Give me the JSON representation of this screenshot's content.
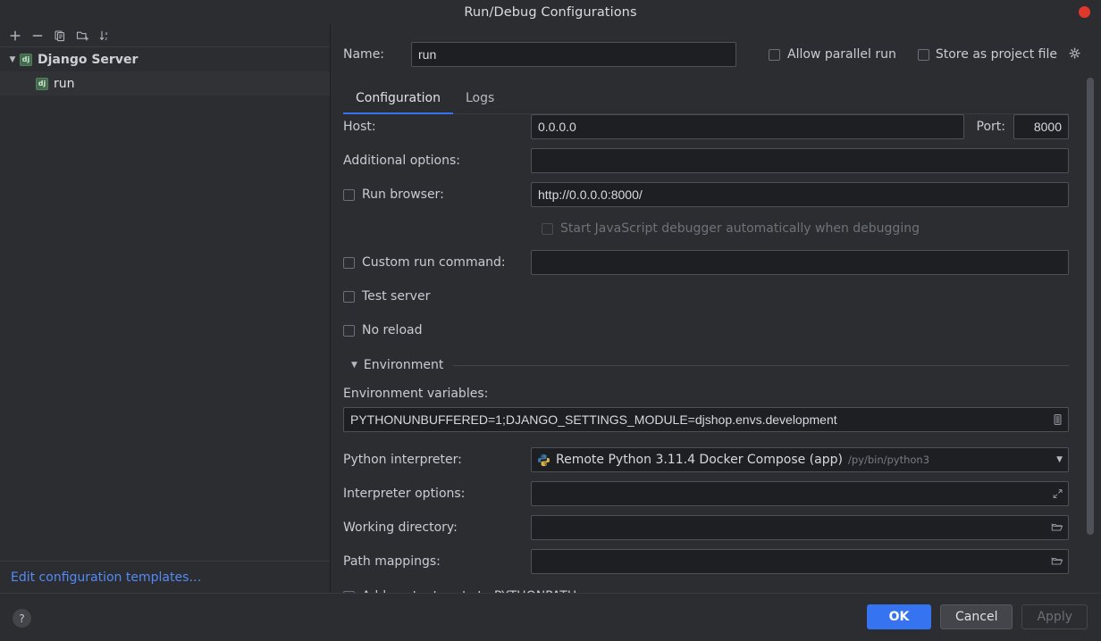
{
  "window": {
    "title": "Run/Debug Configurations",
    "close_icon": "close-dot"
  },
  "sidebar": {
    "toolbar": [
      {
        "icon": "plus-icon",
        "label": "Add New Configuration"
      },
      {
        "icon": "minus-icon",
        "label": "Remove Configuration"
      },
      {
        "icon": "copy-icon",
        "label": "Copy Configuration"
      },
      {
        "icon": "folder-add-icon",
        "label": "Move into New Folder"
      },
      {
        "icon": "sort-alphabetical-icon",
        "label": "Sort Configurations"
      }
    ],
    "tree": [
      {
        "label": "Django Server",
        "icon": "django-icon",
        "type": "group",
        "expanded": true
      },
      {
        "label": "run",
        "icon": "django-icon",
        "type": "child",
        "selected": true
      }
    ],
    "edit_templates_label": "Edit configuration templates…"
  },
  "header": {
    "name_label": "Name:",
    "name_value": "run",
    "allow_parallel_run": {
      "label": "Allow parallel run",
      "checked": false
    },
    "store_as_project_file": {
      "label": "Store as project file",
      "checked": false,
      "gear_icon": "gear-icon"
    }
  },
  "tabs": [
    {
      "label": "Configuration",
      "active": true
    },
    {
      "label": "Logs",
      "active": false
    }
  ],
  "form": {
    "host": {
      "label": "Host:",
      "value": "0.0.0.0"
    },
    "port": {
      "label": "Port:",
      "value": "8000"
    },
    "additional_options": {
      "label": "Additional options:",
      "value": ""
    },
    "run_browser": {
      "label": "Run browser:",
      "checked": false,
      "value": "http://0.0.0.0:8000/"
    },
    "start_js_debugger": {
      "label": "Start JavaScript debugger automatically when debugging",
      "checked": false,
      "disabled": true
    },
    "custom_run_command": {
      "label": "Custom run command:",
      "checked": false,
      "value": ""
    },
    "test_server": {
      "label": "Test server",
      "checked": false
    },
    "no_reload": {
      "label": "No reload",
      "checked": false
    },
    "environment_section": {
      "title": "Environment",
      "expanded": true
    },
    "environment_variables": {
      "label": "Environment variables:",
      "value": "PYTHONUNBUFFERED=1;DJANGO_SETTINGS_MODULE=djshop.envs.development",
      "browse_icon": "env-edit-icon"
    },
    "python_interpreter": {
      "label": "Python interpreter:",
      "value": "Remote Python 3.11.4 Docker Compose (app)",
      "path": "/py/bin/python3",
      "icon": "python-icon",
      "arrow_icon": "chevron-down-icon"
    },
    "interpreter_options": {
      "label": "Interpreter options:",
      "value": "",
      "expand_icon": "expand-icon"
    },
    "working_directory": {
      "label": "Working directory:",
      "value": "",
      "browse_icon": "folder-icon"
    },
    "path_mappings": {
      "label": "Path mappings:",
      "value": "",
      "browse_icon": "folder-icon"
    },
    "add_content_roots": {
      "label": "Add content roots to PYTHONPATH",
      "checked": true
    }
  },
  "footer": {
    "help_label": "?",
    "ok_label": "OK",
    "cancel_label": "Cancel",
    "apply_label": "Apply"
  },
  "colors": {
    "accent": "#3573f0",
    "link": "#548af7",
    "background": "#2b2d30",
    "field_background": "#1e1f22",
    "close_red": "#e2382c",
    "django_green": "#44694d"
  }
}
